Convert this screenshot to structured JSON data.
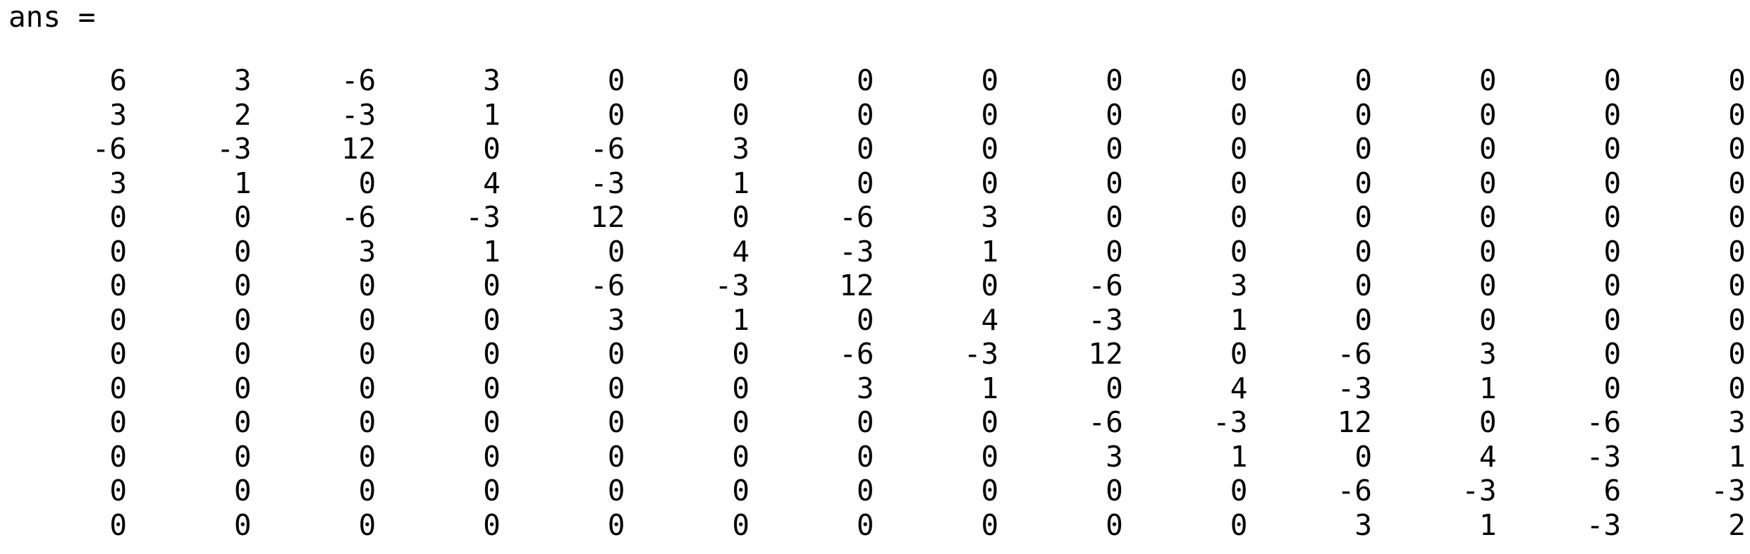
{
  "console": {
    "header": "ans =",
    "matrix": [
      [
        "6",
        "3",
        "-6",
        "3",
        "0",
        "0",
        "0",
        "0",
        "0",
        "0",
        "0",
        "0",
        "0",
        "0"
      ],
      [
        "3",
        "2",
        "-3",
        "1",
        "0",
        "0",
        "0",
        "0",
        "0",
        "0",
        "0",
        "0",
        "0",
        "0"
      ],
      [
        "-6",
        "-3",
        "12",
        "0",
        "-6",
        "3",
        "0",
        "0",
        "0",
        "0",
        "0",
        "0",
        "0",
        "0"
      ],
      [
        "3",
        "1",
        "0",
        "4",
        "-3",
        "1",
        "0",
        "0",
        "0",
        "0",
        "0",
        "0",
        "0",
        "0"
      ],
      [
        "0",
        "0",
        "-6",
        "-3",
        "12",
        "0",
        "-6",
        "3",
        "0",
        "0",
        "0",
        "0",
        "0",
        "0"
      ],
      [
        "0",
        "0",
        "3",
        "1",
        "0",
        "4",
        "-3",
        "1",
        "0",
        "0",
        "0",
        "0",
        "0",
        "0"
      ],
      [
        "0",
        "0",
        "0",
        "0",
        "-6",
        "-3",
        "12",
        "0",
        "-6",
        "3",
        "0",
        "0",
        "0",
        "0"
      ],
      [
        "0",
        "0",
        "0",
        "0",
        "3",
        "1",
        "0",
        "4",
        "-3",
        "1",
        "0",
        "0",
        "0",
        "0"
      ],
      [
        "0",
        "0",
        "0",
        "0",
        "0",
        "0",
        "-6",
        "-3",
        "12",
        "0",
        "-6",
        "3",
        "0",
        "0"
      ],
      [
        "0",
        "0",
        "0",
        "0",
        "0",
        "0",
        "3",
        "1",
        "0",
        "4",
        "-3",
        "1",
        "0",
        "0"
      ],
      [
        "0",
        "0",
        "0",
        "0",
        "0",
        "0",
        "0",
        "0",
        "-6",
        "-3",
        "12",
        "0",
        "-6",
        "3"
      ],
      [
        "0",
        "0",
        "0",
        "0",
        "0",
        "0",
        "0",
        "0",
        "3",
        "1",
        "0",
        "4",
        "-3",
        "1"
      ],
      [
        "0",
        "0",
        "0",
        "0",
        "0",
        "0",
        "0",
        "0",
        "0",
        "0",
        "-6",
        "-3",
        "6",
        "-3"
      ],
      [
        "0",
        "0",
        "0",
        "0",
        "0",
        "0",
        "0",
        "0",
        "0",
        "0",
        "3",
        "1",
        "-3",
        "2"
      ]
    ]
  }
}
